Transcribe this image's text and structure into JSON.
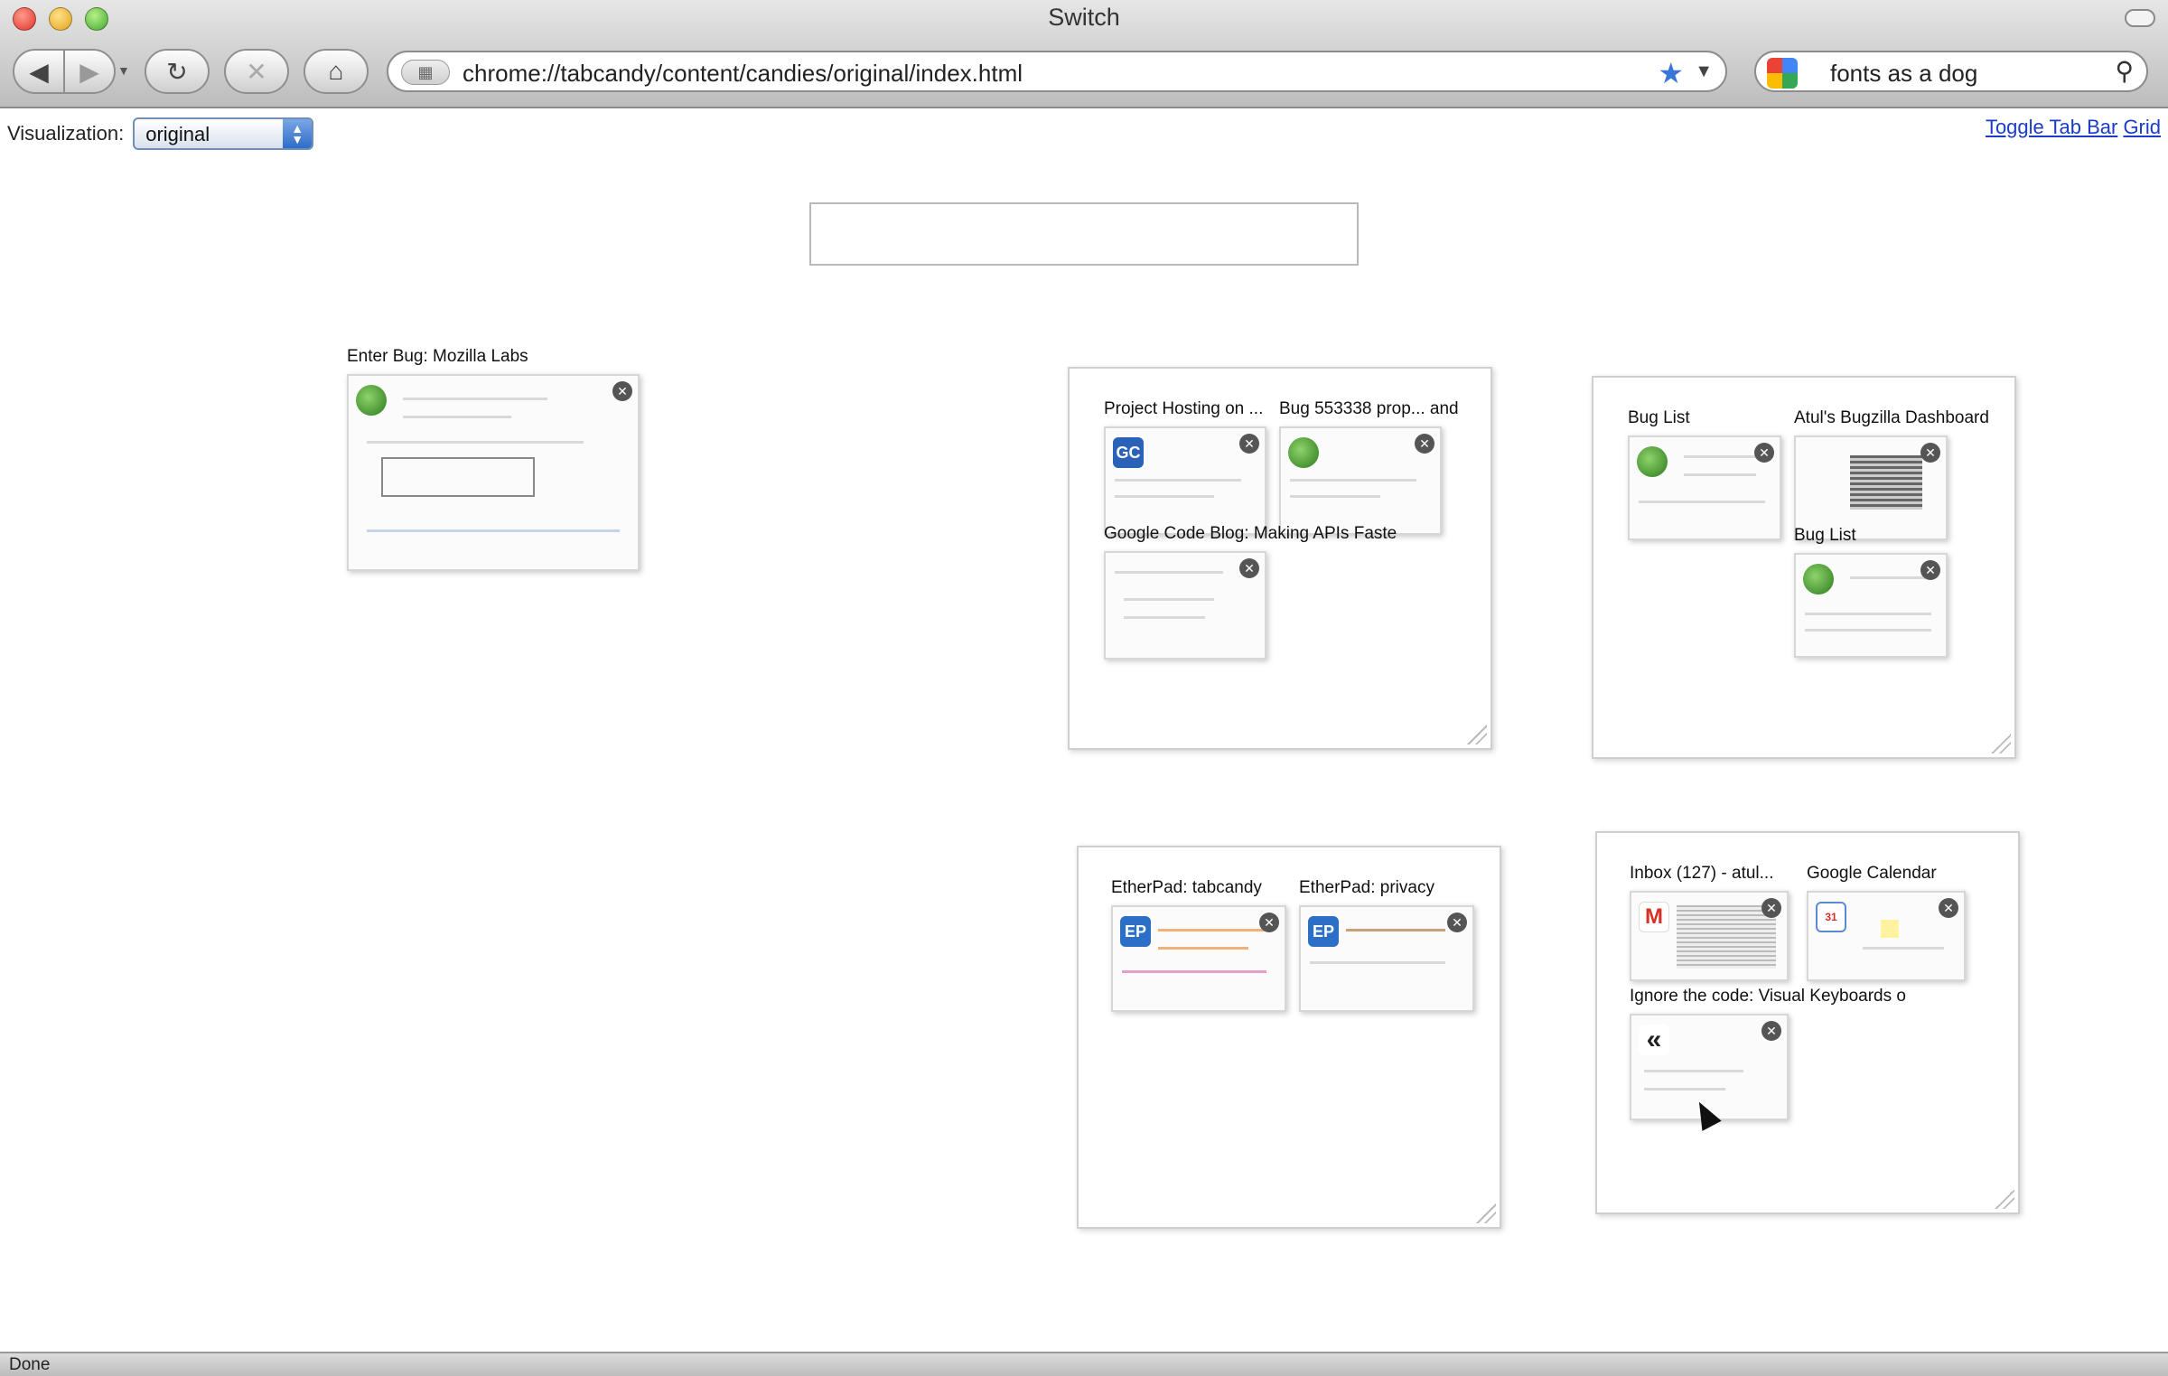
{
  "window": {
    "title": "Switch"
  },
  "toolbar": {
    "url": "chrome://tabcandy/content/candies/original/index.html",
    "search_value": "fonts as a dog"
  },
  "page": {
    "visualization_label": "Visualization:",
    "visualization_value": "original",
    "links": [
      "Toggle Tab Bar",
      "Grid"
    ],
    "search_placeholder": ""
  },
  "tabs": {
    "standalone": {
      "title": "Enter Bug: Mozilla Labs"
    },
    "group1": [
      {
        "title": "Project Hosting on ..."
      },
      {
        "title": "Bug 553338 prop... and"
      },
      {
        "title": "Google Code Blog: Making APIs Faste"
      }
    ],
    "group2": [
      {
        "title": "Bug List"
      },
      {
        "title": "Atul's Bugzilla Dashboard"
      },
      {
        "title": "Bug List"
      }
    ],
    "group3": [
      {
        "title": "EtherPad: tabcandy"
      },
      {
        "title": "EtherPad: privacy"
      }
    ],
    "group4": [
      {
        "title": "Inbox (127) - atul..."
      },
      {
        "title": "Google Calendar"
      },
      {
        "title": "Ignore the code: Visual Keyboards o"
      }
    ]
  },
  "favicons": {
    "google_code": "GC",
    "etherpad": "EP",
    "gmail": "M",
    "calendar": "31",
    "keyboard": "«"
  },
  "status": {
    "text": "Done"
  },
  "colors": {
    "link": "#1a3cc8",
    "accent": "#3a76d8"
  }
}
